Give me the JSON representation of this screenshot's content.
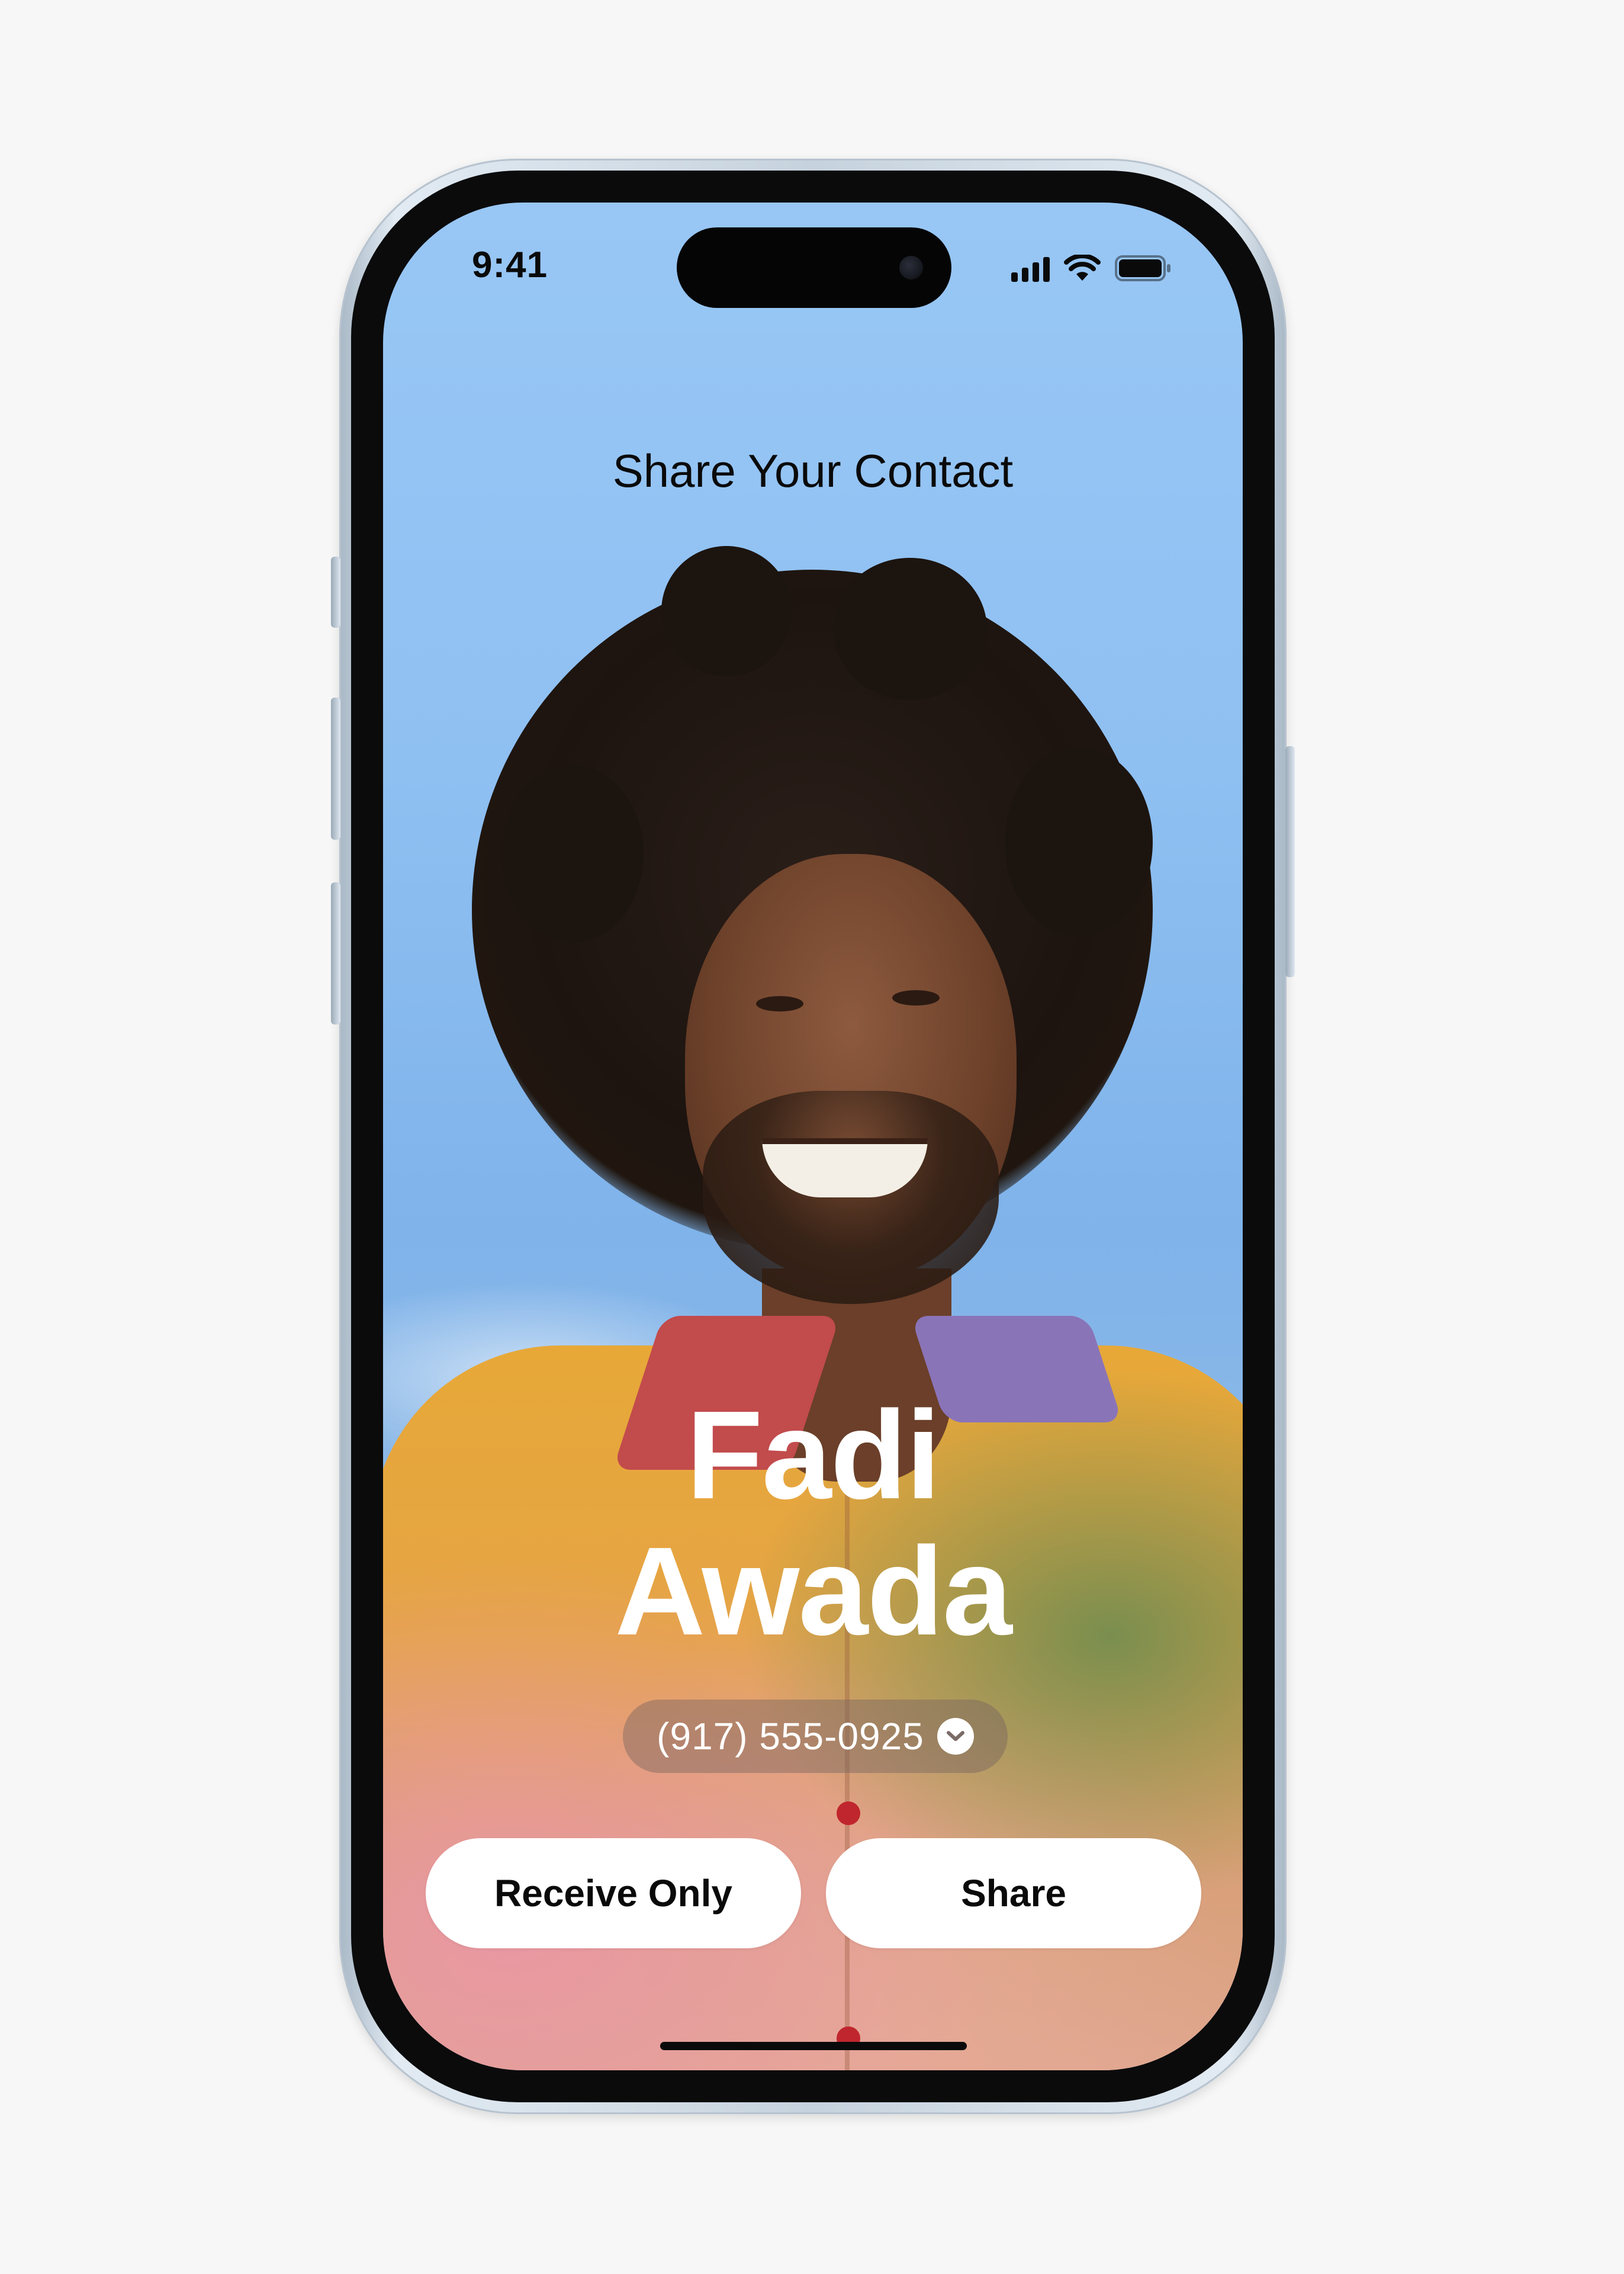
{
  "status_bar": {
    "time": "9:41",
    "icons": [
      "cellular-signal-icon",
      "wifi-icon",
      "battery-icon"
    ]
  },
  "screen": {
    "title": "Share Your Contact",
    "contact": {
      "first_name": "Fadi",
      "last_name": "Awada",
      "phone": "(917) 555-0925",
      "phone_selector_icon": "chevron-down-icon"
    },
    "actions": {
      "receive_only_label": "Receive Only",
      "share_label": "Share"
    }
  },
  "colors": {
    "sky": "#8fc0f2",
    "button_bg": "#ffffff",
    "text_dark": "#0a0a0a",
    "name_text": "#ffffff",
    "phone_pill_bg": "rgba(120,100,95,0.45)"
  }
}
